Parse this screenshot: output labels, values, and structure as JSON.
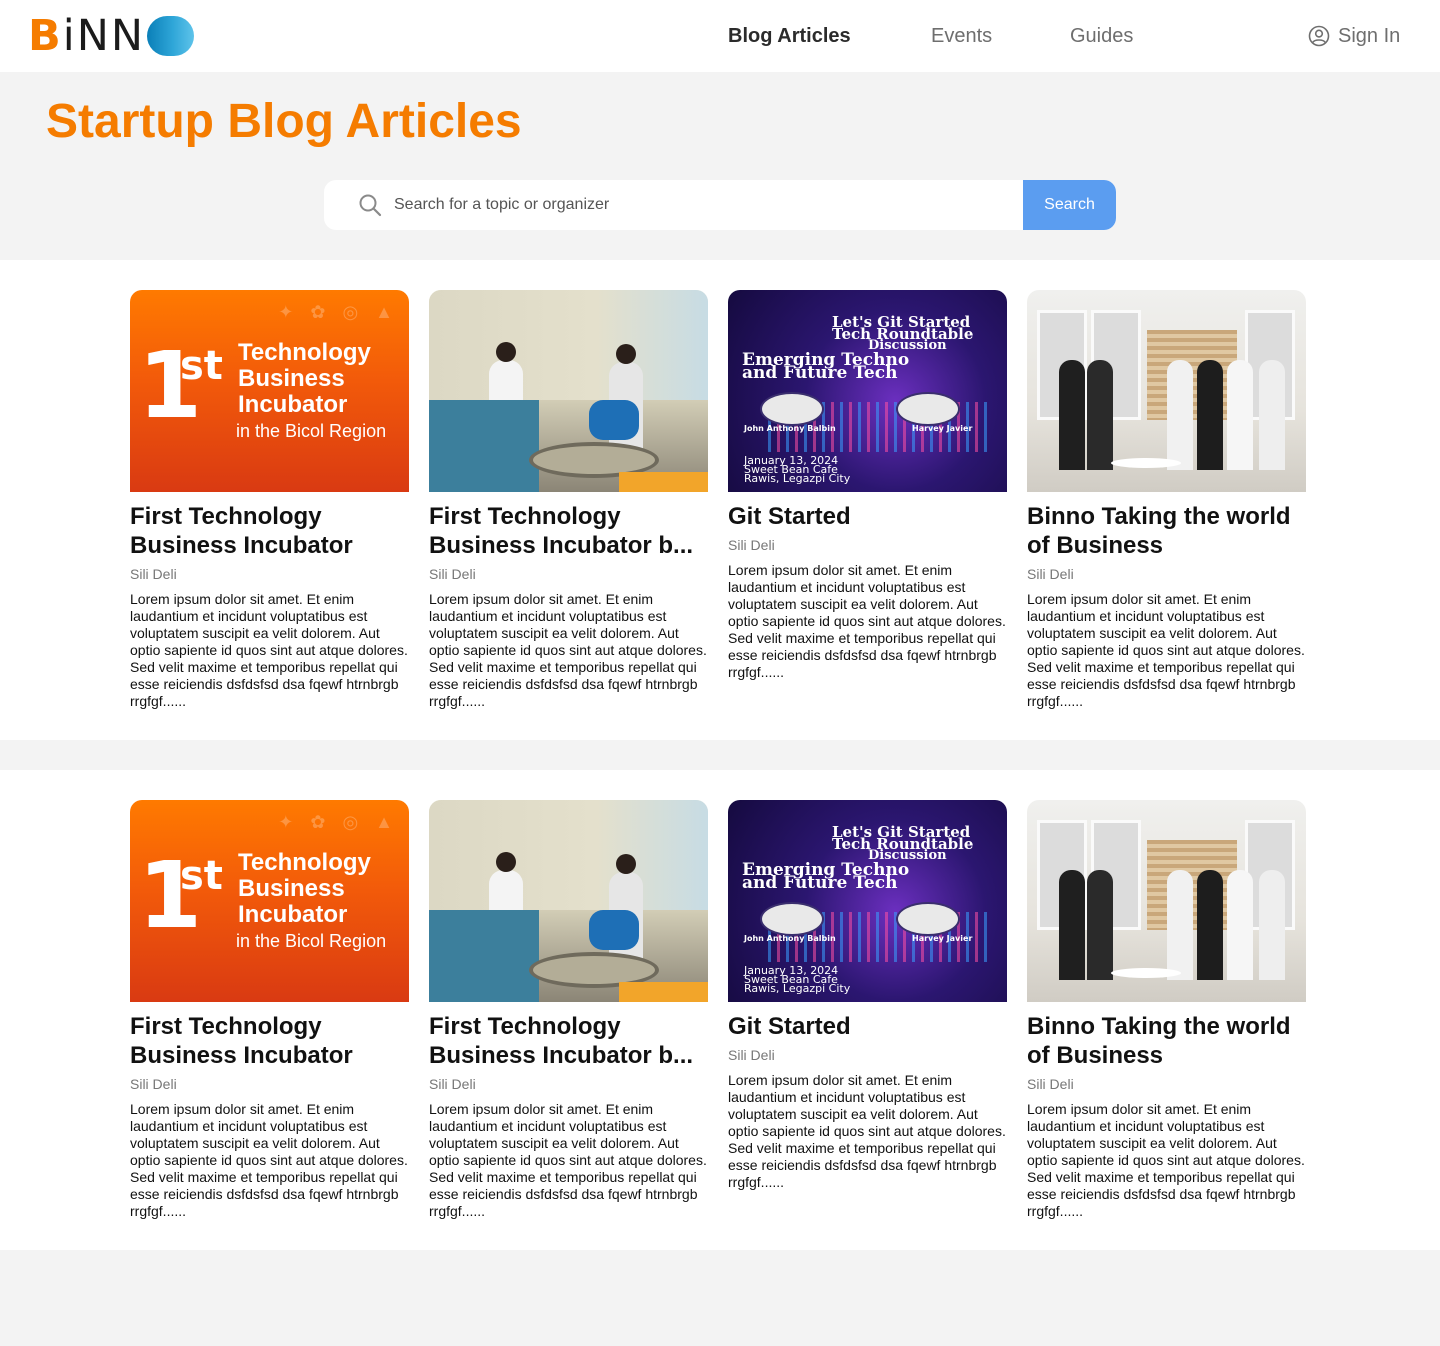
{
  "brand": {
    "logo_letters": "BiNN"
  },
  "nav": {
    "items": [
      {
        "label": "Blog Articles",
        "active": true
      },
      {
        "label": "Events",
        "active": false
      },
      {
        "label": "Guides",
        "active": false
      }
    ],
    "signin_label": "Sign In"
  },
  "page": {
    "title": "Startup Blog Articles"
  },
  "search": {
    "placeholder": "Search for a topic or organizer",
    "value": "",
    "button_label": "Search"
  },
  "thumb_text": {
    "incubator": {
      "num": "1",
      "sup": "st",
      "line1": "Technology",
      "line2": "Business",
      "line3": "Incubator",
      "sub": "in the Bicol Region"
    },
    "git": {
      "top": "Let's Git Started",
      "top2": "Tech Roundtable",
      "top3": "Discussion",
      "big1": "Emerging Techno",
      "big2": "and Future Tech",
      "p1": "John Anthony Balbin",
      "p2": "Harvey Javier",
      "date": "January 13, 2024",
      "venue": "Sweet Bean Cafe",
      "city": "Rawis, Legazpi City"
    }
  },
  "sections": [
    {
      "cards": [
        {
          "title": "First Technology Business Incubator",
          "author": "Sili Deli",
          "excerpt": "Lorem ipsum dolor sit amet. Et enim laudantium et incidunt voluptatibus est voluptatem suscipit ea velit dolorem. Aut optio sapiente id quos sint aut atque dolores. Sed velit maxime et temporibus repellat qui esse reiciendis dsfdsfsd dsa fqewf htrnbrgb rrgfgf......"
        },
        {
          "title": "First Technology Business Incubator b...",
          "author": "Sili Deli",
          "excerpt": "Lorem ipsum dolor sit amet. Et enim laudantium et incidunt voluptatibus est voluptatem suscipit ea velit dolorem. Aut optio sapiente id quos sint aut atque dolores. Sed velit maxime et temporibus repellat qui esse reiciendis dsfdsfsd dsa fqewf htrnbrgb rrgfgf......"
        },
        {
          "title": "Git Started",
          "author": "Sili Deli",
          "excerpt": "Lorem ipsum dolor sit amet. Et enim laudantium et incidunt voluptatibus est voluptatem suscipit ea velit dolorem. Aut optio sapiente id quos sint aut atque dolores. Sed velit maxime et temporibus repellat qui esse reiciendis dsfdsfsd dsa fqewf htrnbrgb rrgfgf......"
        },
        {
          "title": "Binno Taking the world of Business",
          "author": "Sili Deli",
          "excerpt": "Lorem ipsum dolor sit amet. Et enim laudantium et incidunt voluptatibus est voluptatem suscipit ea velit dolorem. Aut optio sapiente id quos sint aut atque dolores. Sed velit maxime et temporibus repellat qui esse reiciendis dsfdsfsd dsa fqewf htrnbrgb rrgfgf......"
        }
      ]
    },
    {
      "cards": [
        {
          "title": "First Technology Business Incubator",
          "author": "Sili Deli",
          "excerpt": "Lorem ipsum dolor sit amet. Et enim laudantium et incidunt voluptatibus est voluptatem suscipit ea velit dolorem. Aut optio sapiente id quos sint aut atque dolores. Sed velit maxime et temporibus repellat qui esse reiciendis dsfdsfsd dsa fqewf htrnbrgb rrgfgf......"
        },
        {
          "title": "First Technology Business Incubator b...",
          "author": "Sili Deli",
          "excerpt": "Lorem ipsum dolor sit amet. Et enim laudantium et incidunt voluptatibus est voluptatem suscipit ea velit dolorem. Aut optio sapiente id quos sint aut atque dolores. Sed velit maxime et temporibus repellat qui esse reiciendis dsfdsfsd dsa fqewf htrnbrgb rrgfgf......"
        },
        {
          "title": "Git Started",
          "author": "Sili Deli",
          "excerpt": "Lorem ipsum dolor sit amet. Et enim laudantium et incidunt voluptatibus est voluptatem suscipit ea velit dolorem. Aut optio sapiente id quos sint aut atque dolores. Sed velit maxime et temporibus repellat qui esse reiciendis dsfdsfsd dsa fqewf htrnbrgb rrgfgf......"
        },
        {
          "title": "Binno Taking the world of Business",
          "author": "Sili Deli",
          "excerpt": "Lorem ipsum dolor sit amet. Et enim laudantium et incidunt voluptatibus est voluptatem suscipit ea velit dolorem. Aut optio sapiente id quos sint aut atque dolores. Sed velit maxime et temporibus repellat qui esse reiciendis dsfdsfsd dsa fqewf htrnbrgb rrgfgf......"
        }
      ]
    }
  ],
  "colors": {
    "brand_orange": "#f57c00",
    "search_button": "#5b9df0",
    "page_bg": "#f3f3f3"
  },
  "icons": {
    "search": "search-icon",
    "signin": "user-circle-icon",
    "logo_o": "gradient-o-logo-mark"
  }
}
